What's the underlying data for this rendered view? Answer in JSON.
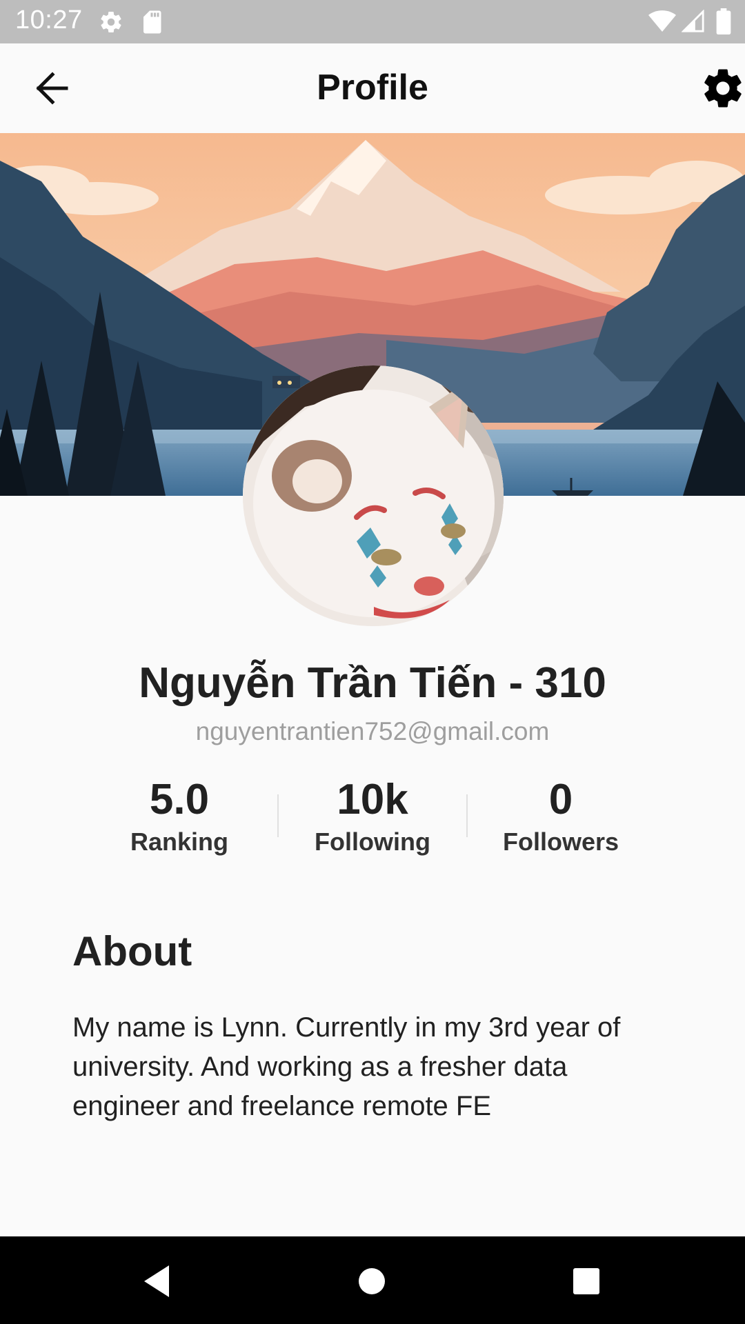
{
  "status_bar": {
    "time": "10:27",
    "icons": [
      "settings-gear-icon",
      "sd-card-icon",
      "wifi-icon",
      "signal-icon",
      "battery-icon"
    ]
  },
  "app_bar": {
    "title": "Profile",
    "back_icon": "arrow-left-icon",
    "settings_icon": "gear-icon"
  },
  "profile": {
    "name": "Nguyễn Trần Tiến - 310",
    "email": "nguyentrantien752@gmail.com"
  },
  "stats": [
    {
      "value": "5.0",
      "label": "Ranking"
    },
    {
      "value": "10k",
      "label": "Following"
    },
    {
      "value": "0",
      "label": "Followers"
    }
  ],
  "about": {
    "title": "About",
    "text": "My name is Lynn. Currently in my 3rd year of university. And working as a fresher data engineer and freelance remote FE"
  },
  "nav_bar": {
    "icons": [
      "back-triangle-icon",
      "home-circle-icon",
      "recents-square-icon"
    ]
  },
  "colors": {
    "background": "#fafafa",
    "status_bar": "#bdbdbd",
    "email_text": "#9e9e9e",
    "nav_bar": "#000000"
  }
}
